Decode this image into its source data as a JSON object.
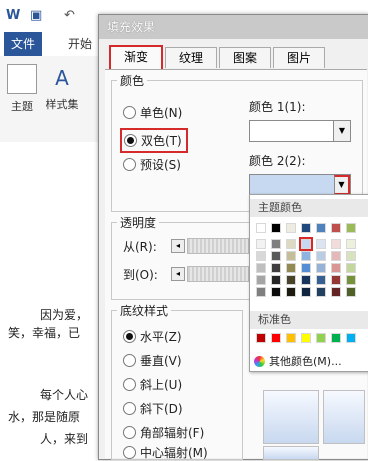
{
  "word": {
    "tabs": {
      "file": "文件",
      "home": "开始"
    },
    "ribbon": {
      "theme": "主题",
      "styleset": "样式集"
    },
    "doc_lines": [
      "因为爱，",
      "笑，幸福，已",
      "每个人心",
      "水，那是随原",
      "人，来到"
    ]
  },
  "dialog": {
    "title": "填充效果",
    "tabs": [
      "渐变",
      "纹理",
      "图案",
      "图片"
    ],
    "colors": {
      "group": "颜色",
      "options": [
        "单色(N)",
        "双色(T)",
        "预设(S)"
      ],
      "color1_label": "颜色 1(1):",
      "color2_label": "颜色 2(2):"
    },
    "transparency": {
      "group": "透明度",
      "from": "从(R):",
      "to": "到(O):"
    },
    "shading": {
      "group": "底纹样式",
      "options": [
        "水平(Z)",
        "垂直(V)",
        "斜上(U)",
        "斜下(D)",
        "角部辐射(F)",
        "中心辐射(M)"
      ]
    }
  },
  "palette": {
    "theme_title": "主题颜色",
    "standard_title": "标准色",
    "more": "其他颜色(M)...",
    "theme_colors": [
      [
        "#ffffff",
        "#000000",
        "#eeece1",
        "#1f497d",
        "#4f81bd",
        "#c0504d",
        "#9bbb59"
      ],
      [
        "#f2f2f2",
        "#7f7f7f",
        "#ddd9c3",
        "#c6d9f1",
        "#dbe5f1",
        "#f2dcdb",
        "#ebf1dd"
      ],
      [
        "#d8d8d8",
        "#595959",
        "#c4bd97",
        "#8db3e2",
        "#b8cce4",
        "#e5b9b7",
        "#d7e3bc"
      ],
      [
        "#bfbfbf",
        "#3f3f3f",
        "#938953",
        "#548dd4",
        "#95b3d7",
        "#d99694",
        "#c3d69b"
      ],
      [
        "#a5a5a5",
        "#262626",
        "#494429",
        "#17365d",
        "#366092",
        "#953734",
        "#76923c"
      ],
      [
        "#7f7f7f",
        "#0c0c0c",
        "#1d1b10",
        "#0f243e",
        "#244061",
        "#632423",
        "#4f6128"
      ]
    ],
    "standard_colors": [
      "#c00000",
      "#ff0000",
      "#ffc000",
      "#ffff00",
      "#92d050",
      "#00b050",
      "#00b0f0"
    ],
    "selected_color": "#c6d9f1",
    "highlight_color": "#d42a2a"
  }
}
